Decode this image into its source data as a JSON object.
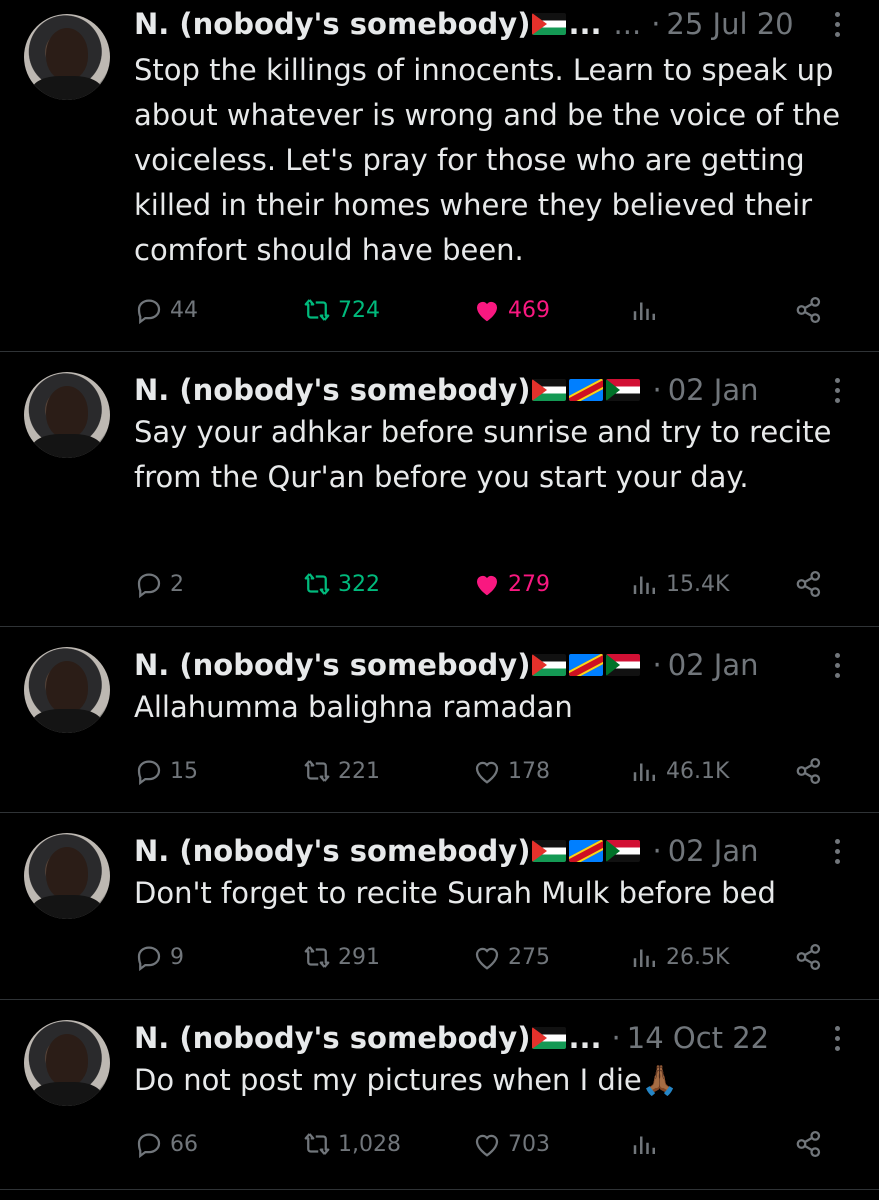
{
  "tweets": [
    {
      "name": "N. (nobody's somebody)",
      "flags": [
        "palestine"
      ],
      "name_ellipsis": "...",
      "handle_ellipsis": "...",
      "separator": "·",
      "date": "25 Jul 20",
      "text": "Stop the killings of innocents. Learn to speak up about whatever is wrong and be the voice of the voiceless. Let's pray for those who are getting killed in their homes where they believed their comfort should have been.",
      "replies": "44",
      "retweets": "724",
      "likes": "469",
      "views": "",
      "retweeted": true,
      "liked": true
    },
    {
      "name": "N. (nobody's somebody)",
      "flags": [
        "palestine",
        "dr-congo",
        "sudan"
      ],
      "separator": "·",
      "date": "02 Jan",
      "text": "Say your adhkar before sunrise and try to recite from the Qur'an before you start your day.",
      "replies": "2",
      "retweets": "322",
      "likes": "279",
      "views": "15.4K",
      "retweeted": true,
      "liked": true
    },
    {
      "name": "N. (nobody's somebody)",
      "flags": [
        "palestine",
        "dr-congo",
        "sudan"
      ],
      "separator": "·",
      "date": "02 Jan",
      "text": "Allahumma balighna ramadan",
      "replies": "15",
      "retweets": "221",
      "likes": "178",
      "views": "46.1K",
      "retweeted": false,
      "liked": false
    },
    {
      "name": "N. (nobody's somebody)",
      "flags": [
        "palestine",
        "dr-congo",
        "sudan"
      ],
      "separator": "·",
      "date": "02 Jan",
      "text": "Don't forget to recite Surah Mulk before bed",
      "replies": "9",
      "retweets": "291",
      "likes": "275",
      "views": "26.5K",
      "retweeted": false,
      "liked": false
    },
    {
      "name": "N. (nobody's somebody)",
      "flags": [
        "palestine"
      ],
      "name_ellipsis": "...",
      "separator": "·",
      "date": "14 Oct 22",
      "text": "Do not post my pictures when I die🙏🏾",
      "replies": "66",
      "retweets": "1,028",
      "likes": "703",
      "views": "",
      "retweeted": false,
      "liked": false
    }
  ],
  "colors": {
    "background": "#000000",
    "text": "#e7e9ea",
    "muted": "#71767b",
    "retweet_active": "#00ba7c",
    "like_active": "#f91880",
    "divider": "#2f3336"
  },
  "icons": {
    "reply": "reply-icon",
    "retweet": "retweet-icon",
    "like": "heart-icon",
    "views": "views-icon",
    "share": "share-icon",
    "more": "more-icon"
  }
}
